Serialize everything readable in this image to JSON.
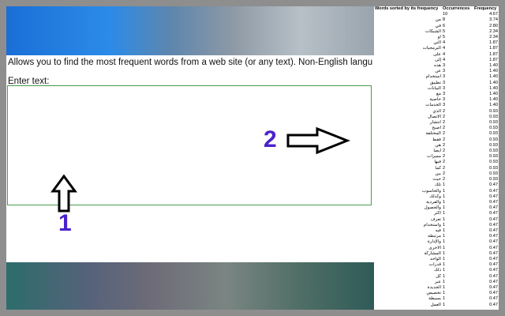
{
  "page": {
    "intro_text": "Allows you to find the most frequent words from a web site (or any text). Non-English language texts are su",
    "enter_label": "Enter text:",
    "textarea_value": ""
  },
  "annotations": {
    "label_1": "1",
    "label_2": "2"
  },
  "results": {
    "headers": [
      "Words sorted by its frequency",
      "Occurrences",
      "Frequency"
    ],
    "rows": [
      [
        "",
        "10",
        "4.67"
      ],
      [
        "من",
        "8",
        "3.74"
      ],
      [
        "في",
        "6",
        "2.80"
      ],
      [
        "الشبكات",
        "5",
        "2.34"
      ],
      [
        "أو",
        "5",
        "2.34"
      ],
      [
        "التي",
        "4",
        "1.87"
      ],
      [
        "البرمجيات",
        "4",
        "1.87"
      ],
      [
        "على",
        "4",
        "1.87"
      ],
      [
        "إلى",
        "4",
        "1.87"
      ],
      [
        "هذه",
        "3",
        "1.40"
      ],
      [
        "عن",
        "3",
        "1.40"
      ],
      [
        "استخدام",
        "3",
        "1.40"
      ],
      [
        "تطبيق",
        "3",
        "1.40"
      ],
      [
        "البيانات",
        "3",
        "1.40"
      ],
      [
        "مع",
        "3",
        "1.40"
      ],
      [
        "خاصية",
        "3",
        "1.40"
      ],
      [
        "الخدمات",
        "3",
        "1.40"
      ],
      [
        "الذي",
        "2",
        "0.93"
      ],
      [
        "الاتصال",
        "2",
        "0.93"
      ],
      [
        "انتشار",
        "2",
        "0.93"
      ],
      [
        "أصبح",
        "2",
        "0.93"
      ],
      [
        "المختلفة",
        "2",
        "0.93"
      ],
      [
        "فقط",
        "2",
        "0.93"
      ],
      [
        "هي",
        "2",
        "0.93"
      ],
      [
        "أيضا",
        "2",
        "0.93"
      ],
      [
        "مميزات",
        "2",
        "0.93"
      ],
      [
        "فيها",
        "2",
        "0.93"
      ],
      [
        "كما",
        "2",
        "0.93"
      ],
      [
        "بين",
        "2",
        "0.93"
      ],
      [
        "حيث",
        "2",
        "0.93"
      ],
      [
        "تلك",
        "1",
        "0.47"
      ],
      [
        "والحاسوب",
        "1",
        "0.47"
      ],
      [
        "وكذلك",
        "1",
        "0.47"
      ],
      [
        "والفردية",
        "1",
        "0.47"
      ],
      [
        "والحصول",
        "1",
        "0.47"
      ],
      [
        "أكثر",
        "1",
        "0.47"
      ],
      [
        "تعرف",
        "1",
        "0.47"
      ],
      [
        "واستخدام",
        "1",
        "0.47"
      ],
      [
        "فيه",
        "1",
        "0.47"
      ],
      [
        "مرتبطة",
        "1",
        "0.47"
      ],
      [
        "والإدارة",
        "1",
        "0.47"
      ],
      [
        "الأخرى",
        "1",
        "0.47"
      ],
      [
        "المشاركة",
        "1",
        "0.47"
      ],
      [
        "الواحد",
        "1",
        "0.47"
      ],
      [
        "قدرات",
        "1",
        "0.47"
      ],
      [
        "ذلك",
        "1",
        "0.47"
      ],
      [
        "كل",
        "1",
        "0.47"
      ],
      [
        "عبر",
        "1",
        "0.47"
      ],
      [
        "الجديدة",
        "1",
        "0.47"
      ],
      [
        "تخصيص",
        "1",
        "0.47"
      ],
      [
        "بسيطة",
        "1",
        "0.47"
      ],
      [
        "العمل",
        "1",
        "0.47"
      ]
    ]
  },
  "colors": {
    "annotation_number": "#4a22cc",
    "textarea_border": "#4c9a4c"
  },
  "icons": {
    "arrow_up": "up-arrow-icon",
    "arrow_right": "right-arrow-icon"
  }
}
